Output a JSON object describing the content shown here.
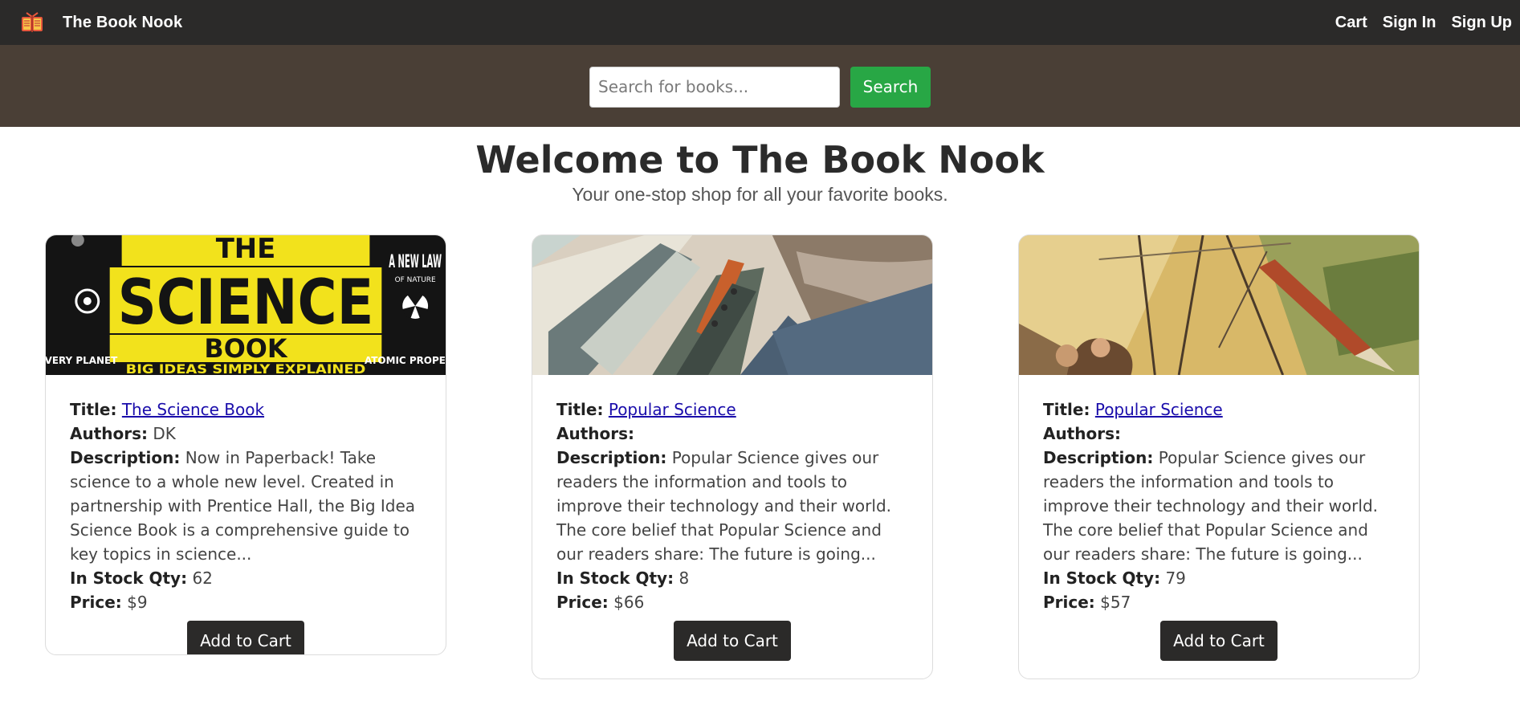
{
  "navbar": {
    "brand": "The Book Nook",
    "links": [
      "Cart",
      "Sign In",
      "Sign Up"
    ]
  },
  "search": {
    "placeholder": "Search for books...",
    "button_label": "Search"
  },
  "hero": {
    "title": "Welcome to The Book Nook",
    "subtitle": "Your one-stop shop for all your favorite books."
  },
  "labels": {
    "title": "Title:",
    "authors": "Authors:",
    "description": "Description:",
    "qty": "In Stock Qty:",
    "price": "Price:"
  },
  "books": [
    {
      "title": "The Science Book",
      "authors": "DK",
      "description": "Now in Paperback! Take science to a whole new level. Created in partnership with Prentice Hall, the Big Idea Science Book is a comprehensive guide to key topics in science...",
      "qty": "62",
      "price": "$9",
      "button": "Add to Cart",
      "cover": {
        "big": "SCIENCE",
        "top": "THE",
        "book": "BOOK",
        "tagline": "BIG IDEAS SIMPLY EXPLAINED",
        "side_right": "A NEW LAW",
        "side_right_small": "OF NATURE",
        "left_small": "EVERY PLANET",
        "right_small": "ATOMIC PROPERTY"
      }
    },
    {
      "title": "Popular Science",
      "authors": "",
      "description": "Popular Science gives our readers the information and tools to improve their technology and their world. The core belief that Popular Science and our readers share: The future is going...",
      "qty": "8",
      "price": "$66",
      "button": "Add to Cart"
    },
    {
      "title": "Popular Science",
      "authors": "",
      "description": "Popular Science gives our readers the information and tools to improve their technology and their world. The core belief that Popular Science and our readers share: The future is going...",
      "qty": "79",
      "price": "$57",
      "button": "Add to Cart"
    }
  ],
  "colors": {
    "navbar": "#2b2a29",
    "search_band": "#4a3f36",
    "search_button": "#28a745",
    "link": "#1a0dab"
  }
}
